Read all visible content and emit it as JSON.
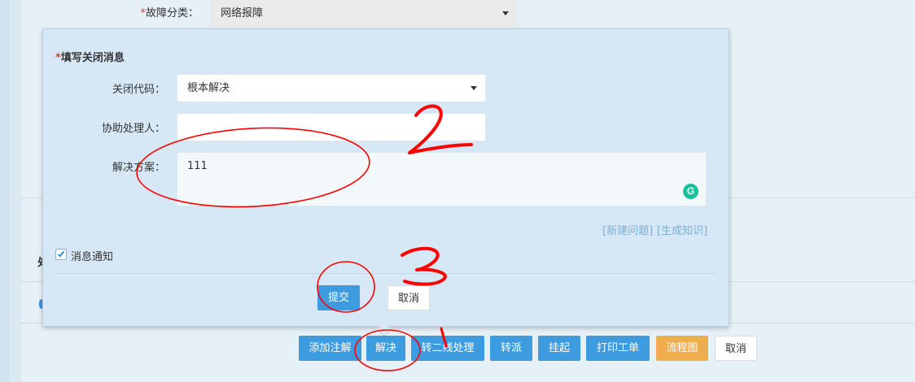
{
  "background": {
    "fault_category": {
      "required_mark": "*",
      "label": "故障分类：",
      "value": "网络报障"
    },
    "partial_glyph": "处"
  },
  "popover": {
    "title": {
      "required_mark": "*",
      "text": "填写关闭消息"
    },
    "close_code": {
      "label": "关闭代码：",
      "value": "根本解决"
    },
    "assistant": {
      "label": "协助处理人：",
      "value": ""
    },
    "solution": {
      "label": "解决方案：",
      "value": "111"
    },
    "links": {
      "new_problem": "[新建问题]",
      "generate_knowledge": "[生成知识]"
    },
    "notify": {
      "label": "消息通知",
      "checked": true
    },
    "submit_label": "提交",
    "cancel_label": "取消"
  },
  "toolbar": {
    "add_note": "添加注解",
    "resolve": "解决",
    "to_second_line": "转二线处理",
    "transfer": "转派",
    "suspend": "挂起",
    "print": "打印工单",
    "flowchart": "流程图",
    "cancel": "取消"
  },
  "annotations": {
    "mark_1": "1",
    "mark_2": "2",
    "mark_3": "3",
    "ink_color": "#ff0000"
  },
  "colors": {
    "primary": "#3d9be0",
    "orange": "#f0ad4e",
    "popover_bg": "#d6e8f5",
    "link": "#7aaed3"
  },
  "icons": {
    "close_code_dropdown": "caret-down",
    "category_dropdown": "caret-down",
    "notify": "checkbox-checked",
    "grammar_assistant": "grammarly-g"
  }
}
